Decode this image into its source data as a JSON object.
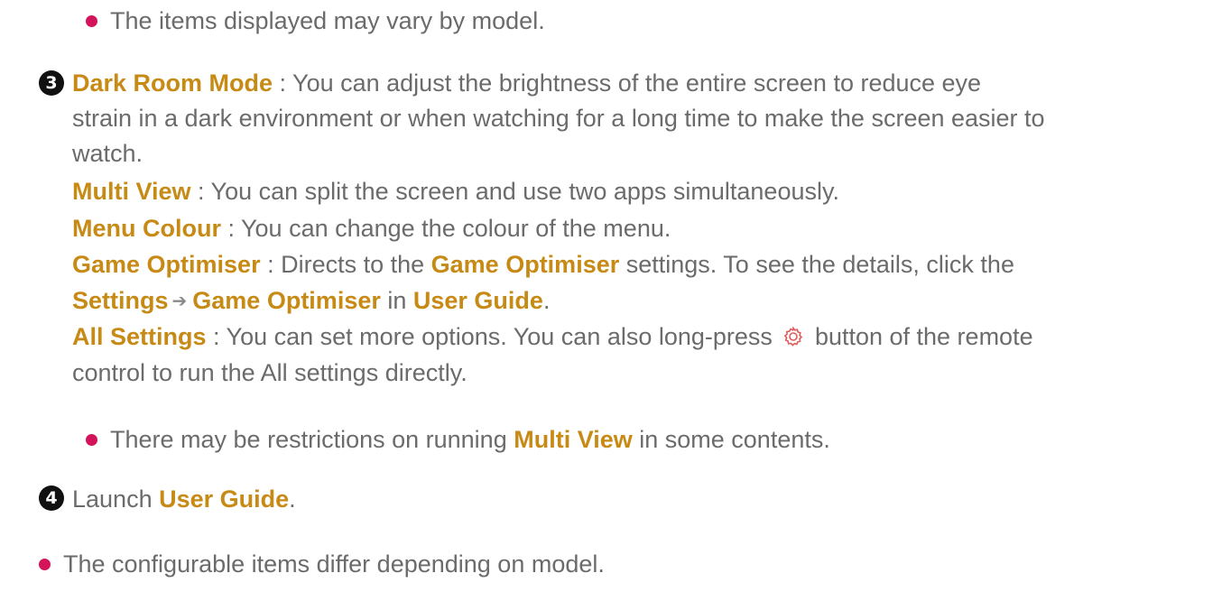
{
  "items_vary_note": "The items displayed may vary by model.",
  "item3": {
    "number": "3",
    "dark_room": {
      "label": "Dark Room Mode",
      "text_line1": " : You can adjust the brightness of the entire screen to reduce eye",
      "text_line2": "strain in a dark environment or when watching for a long time to make the screen easier to",
      "text_line3": "watch."
    },
    "multi_view": {
      "label": "Multi View",
      "text": " : You can split the screen and use two apps simultaneously."
    },
    "menu_colour": {
      "label": "Menu Colour",
      "text": " : You can change the colour of the menu."
    },
    "game_optimiser": {
      "label": "Game Optimiser",
      "text1": " : Directs to the ",
      "label2": "Game Optimiser",
      "text2": " settings. To see the details, click the",
      "settings": "Settings",
      "arrow": "➔",
      "game_optimiser_link": "Game Optimiser",
      "in": " in ",
      "user_guide": "User Guide",
      "period": "."
    },
    "all_settings": {
      "label": "All Settings",
      "text1": " : You can set more options. You can also long-press ",
      "gear_icon": "gear-icon",
      "text2": " button of the remote",
      "text_line2": "control to run the All settings directly."
    },
    "restriction_note": {
      "text1": "There may be restrictions on running ",
      "label": "Multi View",
      "text2": " in some contents."
    }
  },
  "item4": {
    "number": "4",
    "text1": "Launch ",
    "label": "User Guide",
    "period": "."
  },
  "configurable_note": "The configurable items differ depending on model.",
  "colors": {
    "highlight": "#c68a15",
    "bullet": "#d4145a",
    "body_text": "#6b6b6b",
    "gear_icon": "#e05a5a"
  }
}
